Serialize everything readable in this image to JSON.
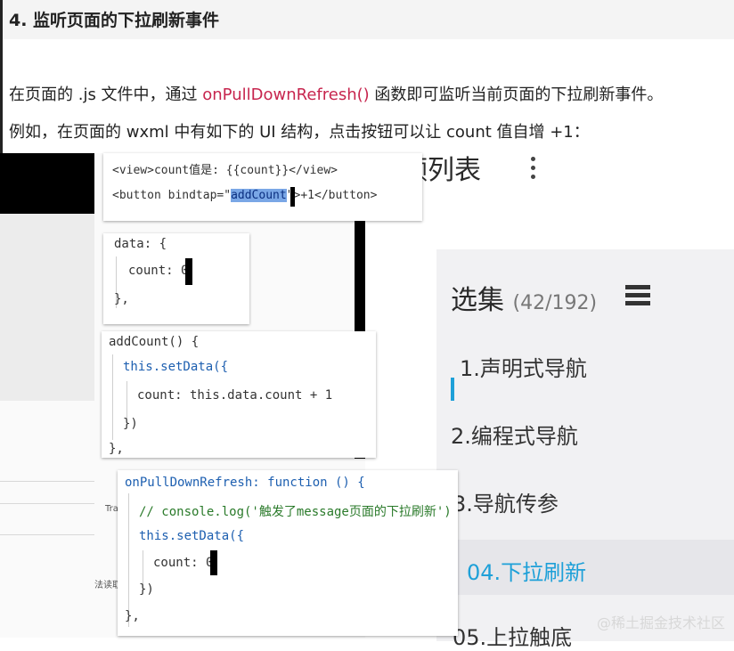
{
  "doc": {
    "heading": "4. 监听页面的下拉刷新事件",
    "para1_pre": "在页面的 .js 文件中，通过 ",
    "para1_code": "onPullDownRefresh()",
    "para1_post": " 函数即可监听当前页面的下拉刷新事件。",
    "para2": "例如，在页面的 wxml 中有如下的 UI 结构，点击按钮可以让 count 值自增 +1："
  },
  "playlist": {
    "title_partial": "视频列表",
    "section_label": "选集",
    "section_count": "(42/192)",
    "items": [
      {
        "label": "1.声明式导航",
        "active": false
      },
      {
        "label": "2.编程式导航",
        "active": false
      },
      {
        "label": "3.导航传参",
        "active": false
      },
      {
        "label": "04.下拉刷新",
        "active": true
      },
      {
        "label": "05.上拉触底",
        "active": false
      }
    ],
    "accent_color": "#1ea0d8"
  },
  "code": {
    "wxml_line1": "<view>count值是: {{count}}</view>",
    "wxml_line2_pre": "<button bindtap=\"",
    "wxml_line2_sel": "addCount",
    "wxml_line2_post": "\">+1</button>",
    "data_line1": "data: {",
    "data_line2": "count: 0",
    "data_line3": "},",
    "add_line1": "addCount() {",
    "add_line2": "this.setData({",
    "add_line3": "count: this.data.count + 1",
    "add_line4": "})",
    "add_line5": "},",
    "pull_line1": "onPullDownRefresh: function () {",
    "pull_line2": "// console.log('触发了message页面的下拉刷新')",
    "pull_line3": "this.setData({",
    "pull_line4": "count: 0",
    "pull_line5": "})",
    "pull_line6": "},"
  },
  "background": {
    "ghost_text_1": "Tra",
    "ghost_text_2": "法读取"
  },
  "watermark": "@稀土掘金技术社区"
}
